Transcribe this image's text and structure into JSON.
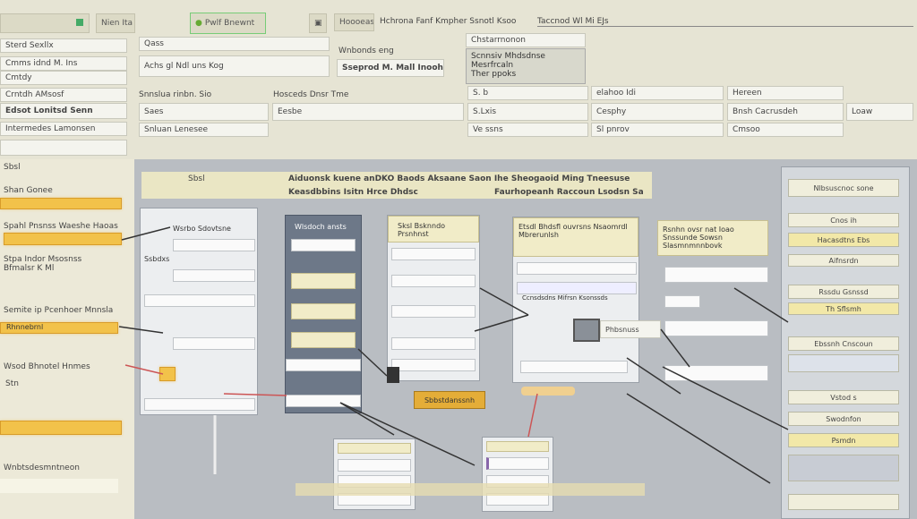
{
  "toolbar": {
    "items": [
      "Nien Ita",
      "Pwlf Bnewnt",
      "Hoooeas",
      "Hchrona Fanf Kmpher Ssnotl Ksoo",
      "Taccnod Wl Mi EJs"
    ]
  },
  "left_list": {
    "items": [
      "Sterd Sexllx",
      "Cmms idnd M. Ins",
      "Cmtdy",
      "Crntdh AMsosf",
      "Edsot Lonitsd Senn",
      "Intermedes Lamonsen"
    ]
  },
  "form": {
    "field1": "Qass",
    "field2": "Achs gl Ndl uns Kog",
    "field3": "Wnbonds eng",
    "field4": "Sseprod M. Mall Inooh",
    "field5": "Chstarrnonon",
    "field6": "Scnnsiv Mhdsdnse Mesrfrcaln",
    "field7": "Ther ppoks"
  },
  "grid": {
    "headers": [
      "Snnslua rinbn. Sio",
      "Hosceds Dnsr Tme",
      "S. b",
      "elahoo Idi",
      "Hereen"
    ],
    "row1": [
      "Saes",
      "Eesbe",
      "S.Lxis",
      "Cesphy",
      "Bnsh Cacrusdeh",
      "Loaw"
    ],
    "row2": [
      "Snluan Lenesee",
      "Ve ssns",
      "Sl pnrov",
      "Cmsoo"
    ]
  },
  "diagram": {
    "title": "Sbsl",
    "header1": "Aiduonsk kuene anDKO Baods Aksaane Saon Ihe Sheogaoid Ming Tneesuse",
    "header2": "Keasdbbins Isitn Hrce Dhdsc",
    "header3": "Faurhopeanh Raccoun Lsodsn Sa",
    "left_labels": [
      "Shan Gonee",
      "Spahl Pnsnss Waeshe Haoas",
      "Stpa Indor Msosnss Bfmalsr K Ml",
      "Semite ip Pcenhoer Mnnsla",
      "Wsod Bhnotel Hnmes",
      "Stn",
      "Wnbtsdesmntneon"
    ],
    "left_bar_labels": [
      "Rhnnebrnl"
    ],
    "panel1": {
      "header": "Wsrbo Sdovtsne",
      "rows": [
        "Ssbdxs"
      ]
    },
    "panel2": {
      "header": "Wlsdoch ansts"
    },
    "panel3": {
      "header": "Sksl Bsknndo Prsnhnst"
    },
    "panel4": {
      "header": "Etsdl Bhdsfl ouvrsns Nsaomrdl Mbrerunlsh",
      "footer": "Ccnsdsdns Mifrsn Ksonssds"
    },
    "panel5": {
      "header": "Rsnhn ovsr nat Ioao Snssunde Sowsn Slasmnmnnbovk"
    },
    "node": "Phbsnuss",
    "button": "Sbbstdanssnh",
    "right_column": [
      "Nlbsuscnoc sone",
      "Cnos ih",
      "Hacasdtns Ebs",
      "Aifnsrdn",
      "Rssdu Gsnssd",
      "Th Sflsmh",
      "Ebssnh Cnscoun",
      "Vstod s",
      "Swodnfon",
      "Psmdn"
    ]
  }
}
